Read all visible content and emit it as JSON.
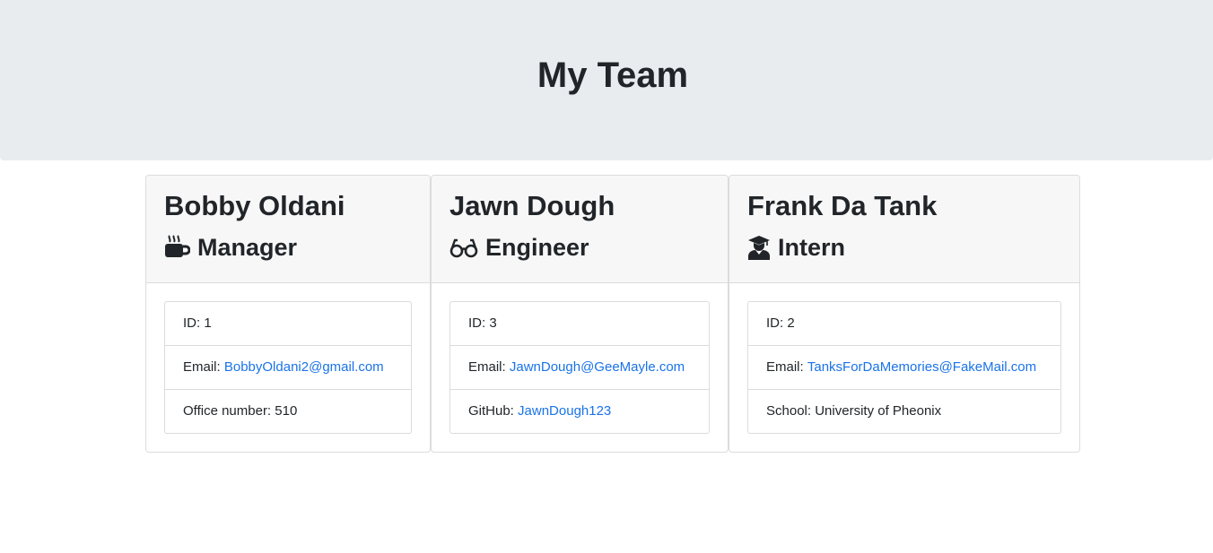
{
  "header": {
    "title": "My Team"
  },
  "team": [
    {
      "name": "Bobby Oldani",
      "role": "Manager",
      "icon": "coffee-mug-icon",
      "id_label": "ID:",
      "id": "1",
      "email_label": "Email:",
      "email": "BobbyOldani2@gmail.com",
      "extra_label": "Office number:",
      "extra": "510"
    },
    {
      "name": "Jawn Dough",
      "role": "Engineer",
      "icon": "glasses-icon",
      "id_label": "ID:",
      "id": "3",
      "email_label": "Email:",
      "email": "JawnDough@GeeMayle.com",
      "extra_label": "GitHub:",
      "extra": "JawnDough123"
    },
    {
      "name": "Frank Da Tank",
      "role": "Intern",
      "icon": "graduate-icon",
      "id_label": "ID:",
      "id": "2",
      "email_label": "Email:",
      "email": "TanksForDaMemories@FakeMail.com",
      "extra_label": "School:",
      "extra": "University of Pheonix"
    }
  ],
  "colors": {
    "jumbotron_bg": "#e9ecef",
    "card_header_bg": "#f7f7f7",
    "link": "#1a73e8",
    "text": "#212529"
  }
}
